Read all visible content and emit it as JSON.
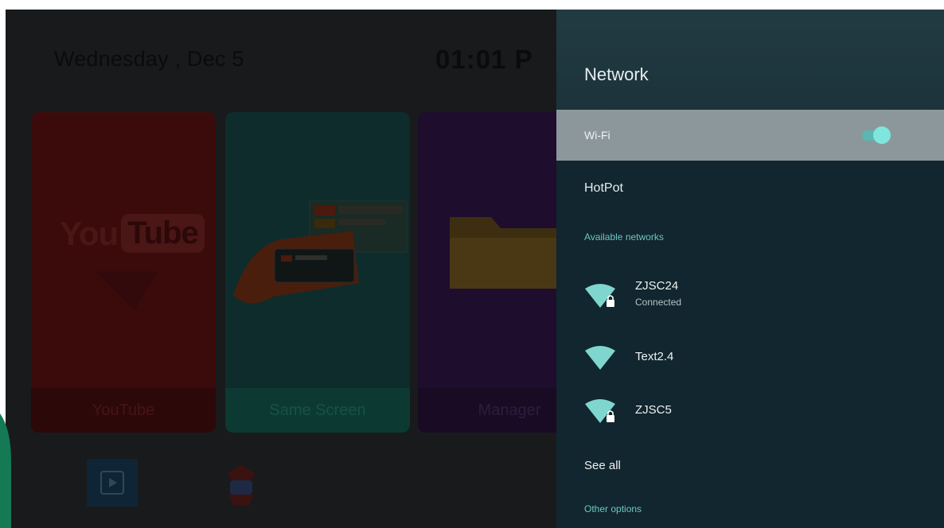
{
  "launcher": {
    "date": "Wednesday , Dec 5",
    "time": "01:01  P",
    "tiles": [
      {
        "label": "YouTube",
        "logo_you": "You",
        "logo_tube": "Tube"
      },
      {
        "label": "Same Screen"
      },
      {
        "label": "Manager"
      }
    ],
    "bottom_icons": [
      "media-player-icon",
      "bot-app-icon"
    ]
  },
  "panel": {
    "title": "Network",
    "wifi": {
      "label": "Wi-Fi",
      "enabled": true
    },
    "hotspot_label": "HotPot",
    "available_label": "Available networks",
    "networks": [
      {
        "name": "ZJSC24",
        "status": "Connected",
        "locked": true
      },
      {
        "name": "Text2.4",
        "status": "",
        "locked": false
      },
      {
        "name": "ZJSC5",
        "status": "",
        "locked": true
      }
    ],
    "see_all_label": "See all",
    "other_options_label": "Other options"
  },
  "colors": {
    "accent": "#6dc6c0",
    "toggle_on": "#7fe6dd",
    "panel_bg": "#11262e",
    "edge_accent": "#147a55"
  }
}
